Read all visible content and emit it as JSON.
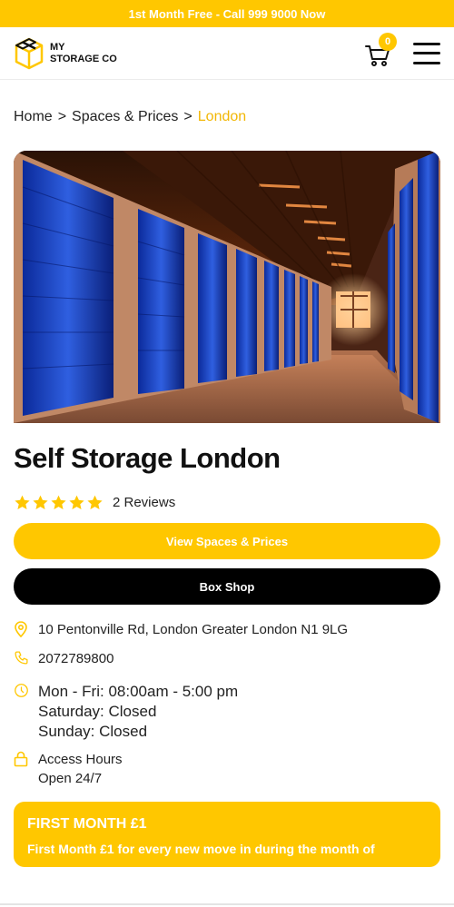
{
  "promo": {
    "text": "1st Month Free - Call 999 9000 Now"
  },
  "header": {
    "logo_line1": "MY",
    "logo_line2": "STORAGE CO",
    "cart_count": "0"
  },
  "breadcrumb": {
    "home": "Home",
    "sep1": ">",
    "spaces": "Spaces & Prices",
    "sep2": ">",
    "current": "London"
  },
  "page": {
    "title": "Self Storage London",
    "rating_stars": 5,
    "reviews": "2 Reviews"
  },
  "buttons": {
    "view_spaces": "View Spaces & Prices",
    "box_shop": "Box Shop"
  },
  "info": {
    "address": "10 Pentonville Rd, London Greater London N1 9LG",
    "phone": "2072789800",
    "hours_weekday": "Mon - Fri: 08:00am - 5:00 pm",
    "hours_saturday": "Saturday: Closed",
    "hours_sunday": "Sunday: Closed",
    "access_label": "Access Hours",
    "access_value": "Open 24/7"
  },
  "offer": {
    "title": "FIRST MONTH £1",
    "text": "First Month £1 for every new move in during the month of"
  },
  "colors": {
    "accent": "#FFC700",
    "dark": "#000000"
  }
}
